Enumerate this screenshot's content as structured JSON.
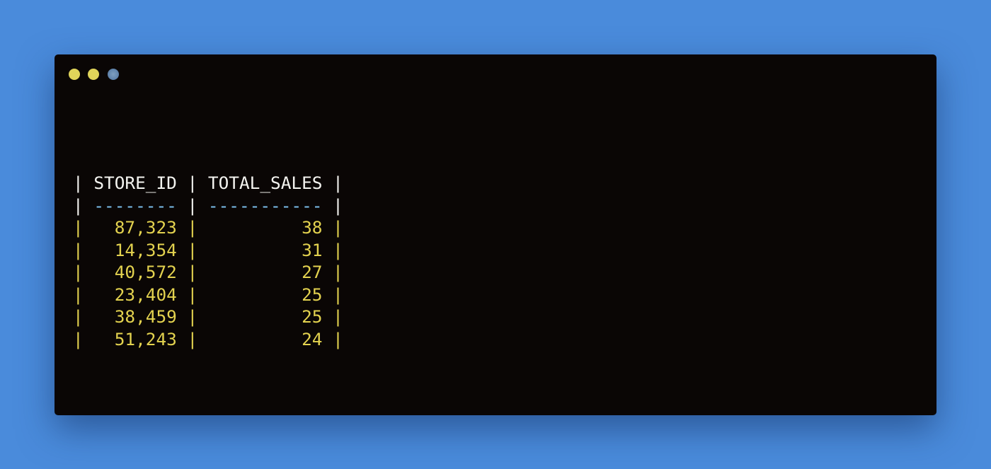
{
  "window": {
    "controls": [
      {
        "name": "close",
        "color": "#e0d45a"
      },
      {
        "name": "minimize",
        "color": "#e0d45a"
      },
      {
        "name": "maximize",
        "color": "#5b7fa8"
      }
    ]
  },
  "table": {
    "columns": [
      "STORE_ID",
      "TOTAL_SALES"
    ],
    "separators": [
      "--------",
      "-----------"
    ],
    "rows": [
      [
        "87,323",
        "38"
      ],
      [
        "14,354",
        "31"
      ],
      [
        "40,572",
        "27"
      ],
      [
        "23,404",
        "25"
      ],
      [
        "38,459",
        "25"
      ],
      [
        "51,243",
        "24"
      ]
    ]
  },
  "colors": {
    "background": "#4a8bdb",
    "terminal": "#0a0605",
    "header": "#f4f4f0",
    "dash": "#7fc4f2",
    "row": "#e3d24f"
  }
}
